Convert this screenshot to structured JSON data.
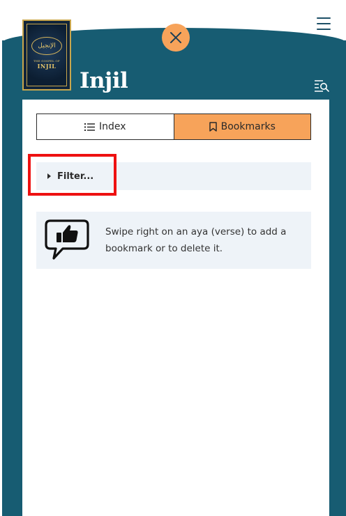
{
  "app": {
    "title": "Injil"
  },
  "book_cover": {
    "subtitle": "THE GOSPEL OF",
    "title": "INJIL",
    "calligraphy": "الإنجيل"
  },
  "tabs": [
    {
      "label": "Index",
      "icon": "list-icon",
      "active": false
    },
    {
      "label": "Bookmarks",
      "icon": "bookmark-icon",
      "active": true
    }
  ],
  "filter": {
    "label": "Filter..."
  },
  "hint": {
    "text": "Swipe right on an aya (verse) to add a bookmark or to delete it.",
    "icon": "thumbs-up-speech-icon"
  },
  "colors": {
    "header_teal": "#175c72",
    "accent_orange": "#f7a35a",
    "panel_bg": "#eef3f8",
    "highlight_red": "#ee1111"
  }
}
